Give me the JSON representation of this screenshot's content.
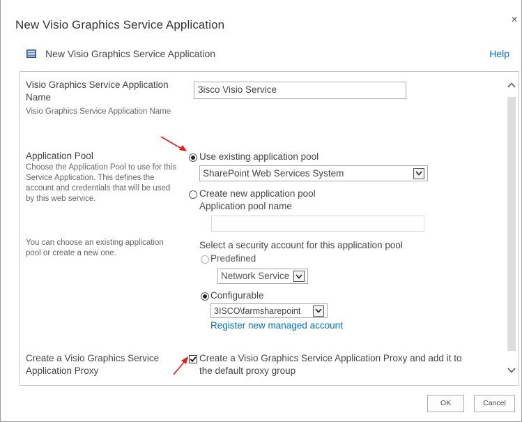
{
  "dialog": {
    "title": "New Visio Graphics Service Application",
    "close_glyph": "×",
    "subtitle": "New Visio Graphics Service Application",
    "help_label": "Help",
    "icon": "service-application-icon"
  },
  "form": {
    "name_section": {
      "label": "Visio Graphics Service Application Name",
      "description": "Visio Graphics Service Application Name",
      "value": "3isco Visio Service"
    },
    "pool_section": {
      "label": "Application Pool",
      "description": "Choose the Application Pool to use for this Service Application.  This defines the account and credentials that will be used by this web service.",
      "description2": "You can choose an existing application pool or create a new one.",
      "use_existing_label": "Use existing application pool",
      "use_existing_selected": true,
      "existing_pool_value": "SharePoint Web Services System",
      "create_new_label": "Create new application pool",
      "pool_name_label": "Application pool name",
      "pool_name_value": "",
      "security_label": "Select a security account for this application pool",
      "predefined_label": "Predefined",
      "predefined_value": "Network Service",
      "configurable_label": "Configurable",
      "configurable_selected": true,
      "configurable_value": "3ISCO\\farmsharepoint",
      "register_link": "Register new managed account"
    },
    "proxy_section": {
      "label": "Create a Visio Graphics Service Application Proxy",
      "checkbox_label_line1": "Create a Visio Graphics Service Application Proxy and add it to",
      "checkbox_label_line2": "the default proxy group",
      "checked": true
    }
  },
  "buttons": {
    "ok_label": "OK",
    "cancel_label": "Cancel"
  },
  "colors": {
    "link": "#0072c6",
    "annotation_arrow": "#e81818",
    "border": "#c6c6c6"
  }
}
